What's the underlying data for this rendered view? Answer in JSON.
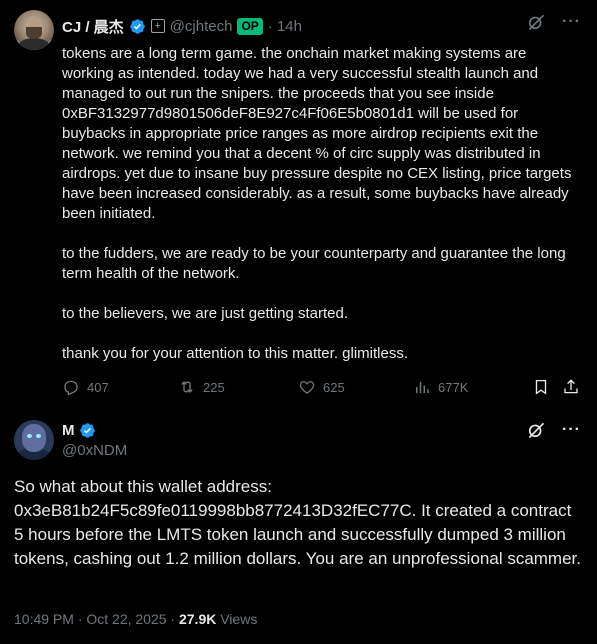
{
  "tweet1": {
    "author_name": "CJ / 晨杰",
    "author_handle": "@cjhtech",
    "op_badge": "OP",
    "time": "· 14h",
    "paragraphs": [
      "tokens are a long term game. the onchain market making systems are working as intended. today we had a very successful stealth launch and managed to out run the snipers. the proceeds that you see inside 0xBF3132977d9801506deF8E927c4Ff06E5b0801d1 will be used for buybacks in appropriate price ranges as more airdrop recipients exit the network. we remind you that a decent % of circ supply was distributed in airdrops. yet due to insane buy pressure despite no CEX listing, price targets have been increased considerably. as a result, some buybacks have already been initiated.",
      "to the fudders, we are ready to be your counterparty and guarantee the long term health of the network.",
      "to the believers, we are just getting started.",
      "thank you for your attention to this matter. glimitless."
    ],
    "stats": {
      "replies": "407",
      "reposts": "225",
      "likes": "625",
      "views": "677K"
    }
  },
  "tweet2": {
    "author_name": "M",
    "author_handle": "@0xNDM",
    "text": "So what about this wallet address: 0x3eB81b24F5c89fe0119998bb8772413D32fEC77C. It created a contract 5 hours before the LMTS token launch and successfully dumped 3 million tokens, cashing out 1.2 million dollars. You are an unprofessional scammer.",
    "timestamp": "10:49 PM · Oct 22, 2025 · ",
    "views_count": "27.9K",
    "views_label": " Views"
  },
  "icons": {
    "verified": "verified-badge-icon",
    "grok": "grok-icon",
    "more": "more-icon",
    "reply": "reply-icon",
    "repost": "repost-icon",
    "like": "heart-icon",
    "views": "views-icon",
    "bookmark": "bookmark-icon",
    "share": "share-icon",
    "more_glyph": "···"
  },
  "colors": {
    "background": "#000000",
    "text": "#e7e9ea",
    "secondary": "#71767b",
    "verified": "#1d9bf0",
    "op_badge": "#00ba7c"
  }
}
